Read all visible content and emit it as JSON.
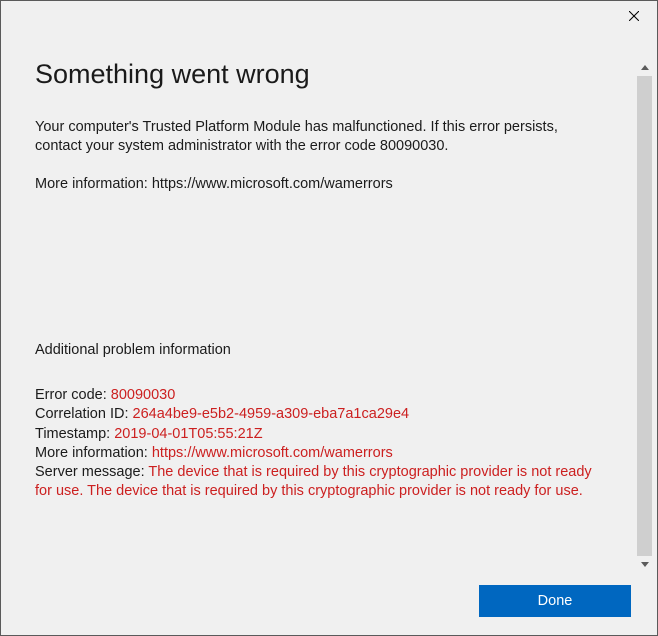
{
  "heading": "Something went wrong",
  "body_text": "Your computer's Trusted Platform Module has malfunctioned. If this error persists, contact your system administrator with the error code 80090030.",
  "more_info_label": "More information: ",
  "more_info_url": "https://www.microsoft.com/wamerrors",
  "additional_title": "Additional problem information",
  "details": {
    "error_code_label": "Error code: ",
    "error_code": "80090030",
    "correlation_label": "Correlation ID: ",
    "correlation": "264a4be9-e5b2-4959-a309-eba7a1ca29e4",
    "timestamp_label": "Timestamp: ",
    "timestamp": "2019-04-01T05:55:21Z",
    "more_info_label": "More information: ",
    "more_info_url": "https://www.microsoft.com/wamerrors",
    "server_msg_label": "Server message: ",
    "server_msg": "The device that is required by this cryptographic provider is not ready for use. The device that is required by this cryptographic provider is not ready for use."
  },
  "done_label": "Done"
}
